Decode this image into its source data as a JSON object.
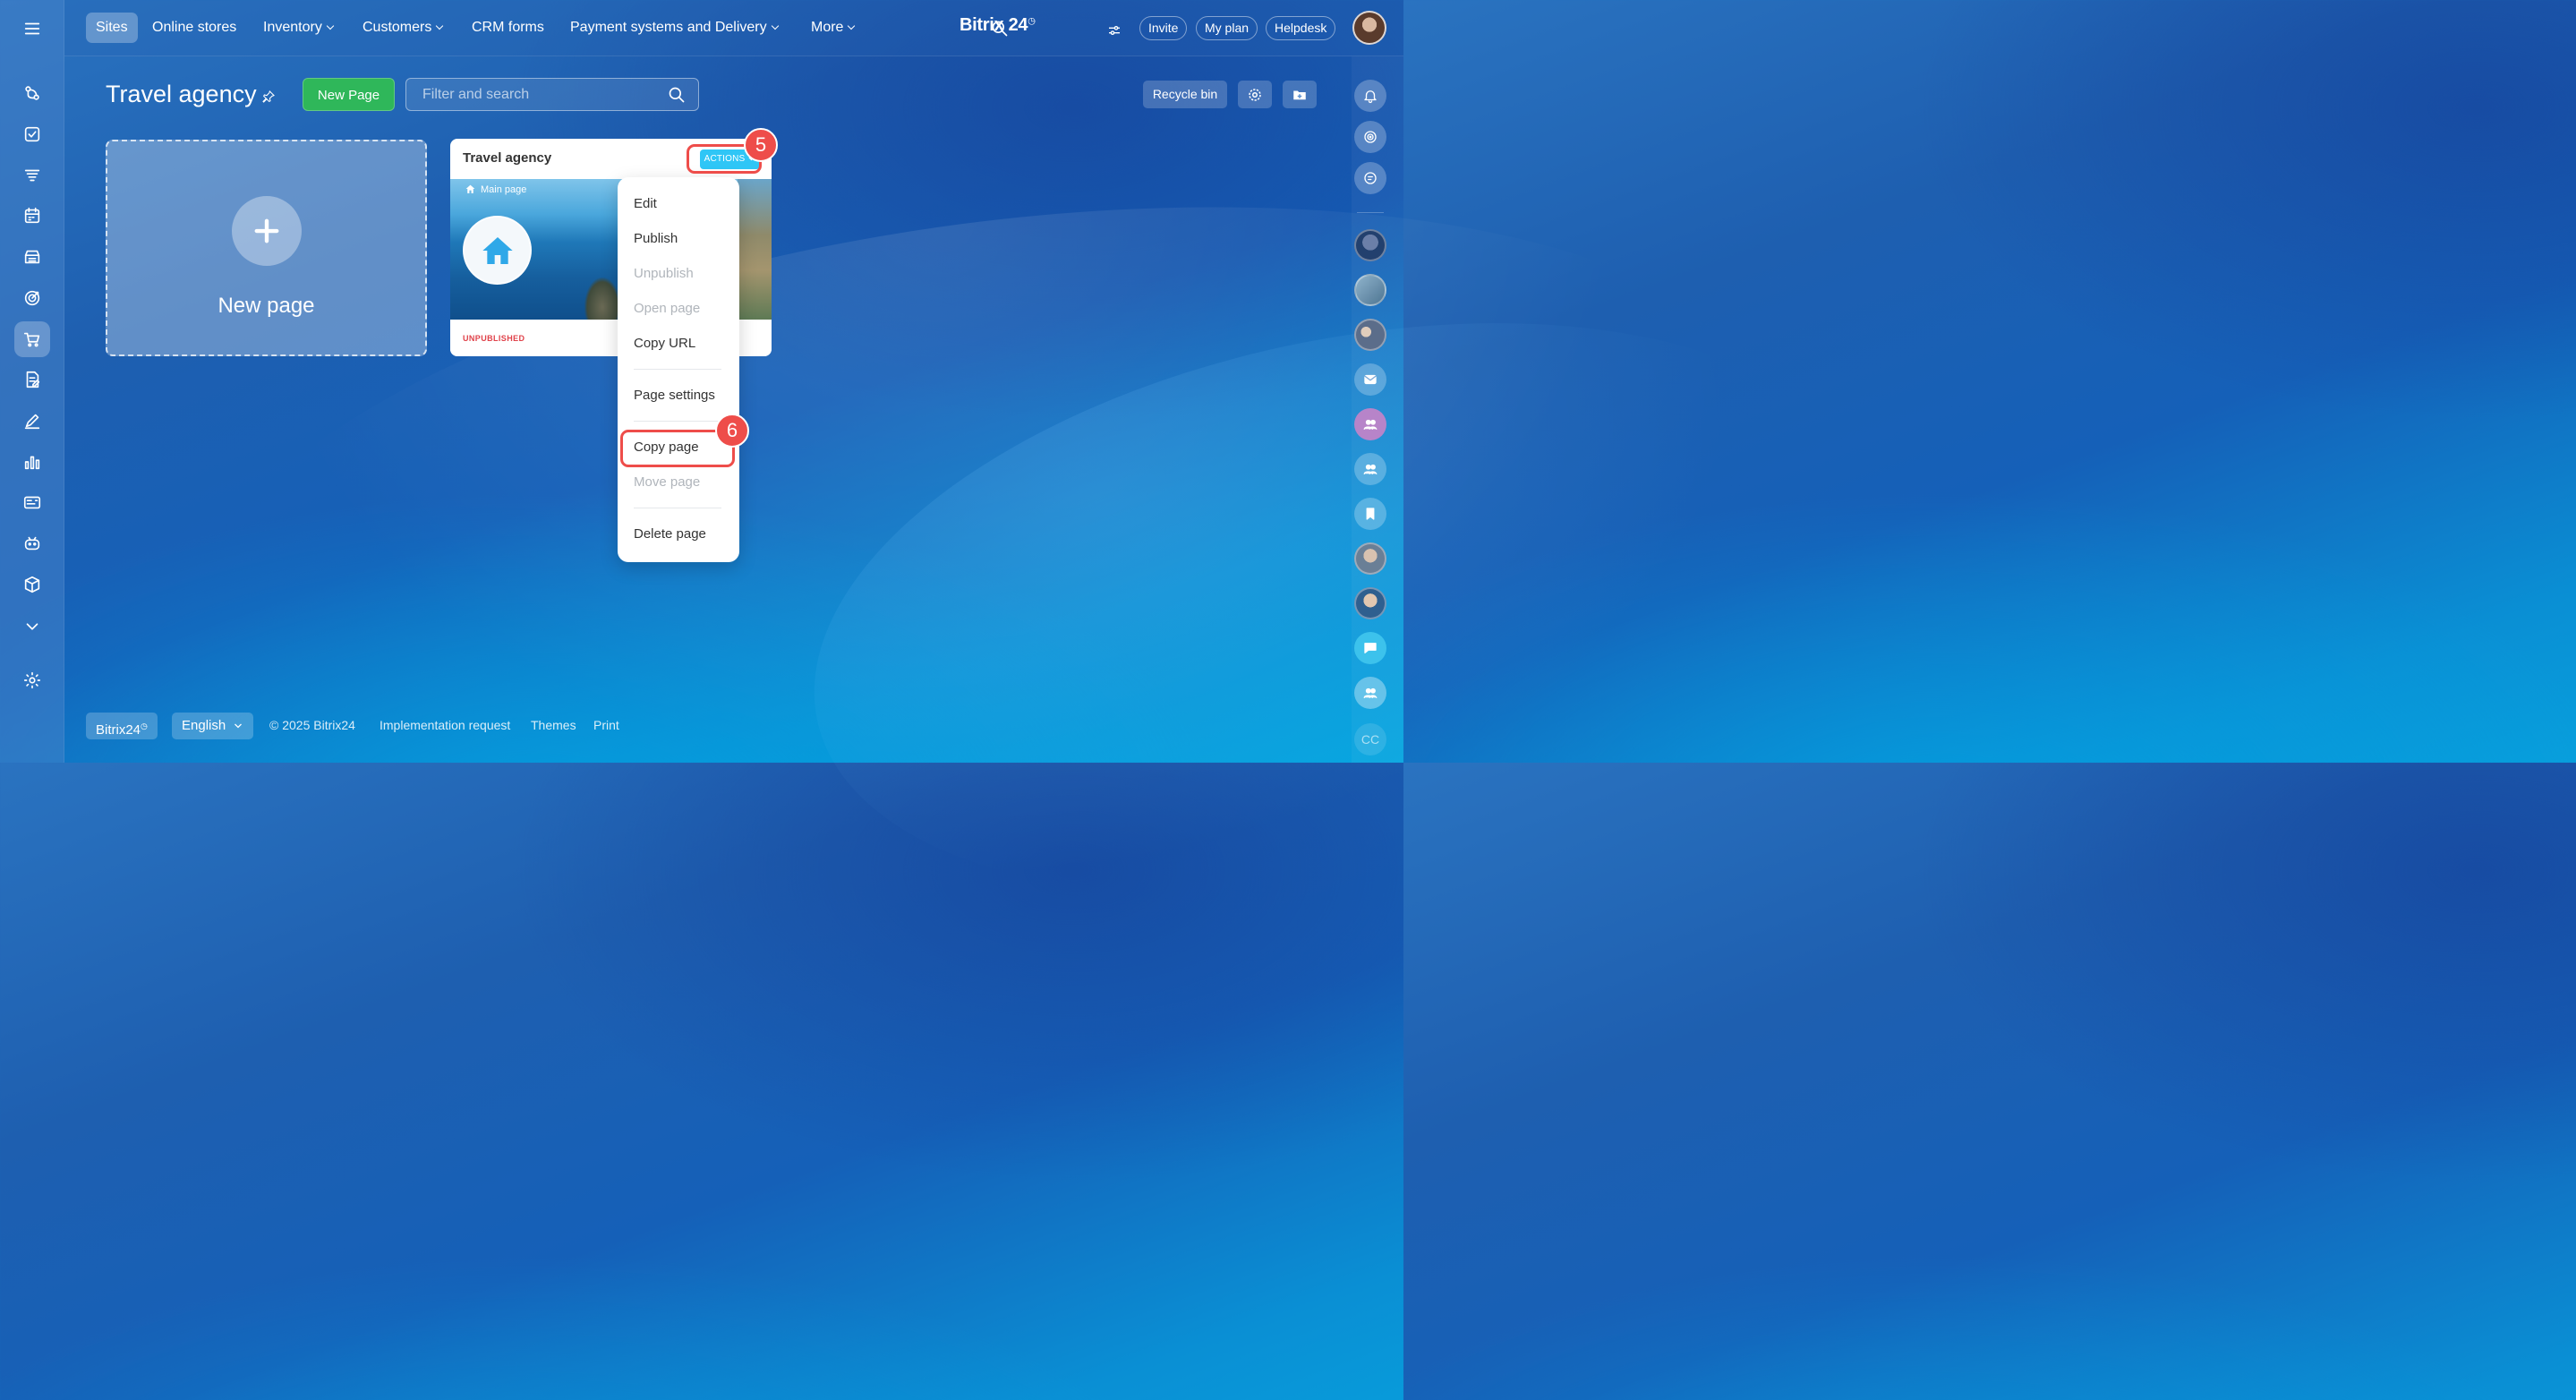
{
  "topnav": {
    "items": [
      {
        "label": "Sites",
        "has_dropdown": false,
        "active": true
      },
      {
        "label": "Online stores",
        "has_dropdown": false
      },
      {
        "label": "Inventory",
        "has_dropdown": true
      },
      {
        "label": "Customers",
        "has_dropdown": true
      },
      {
        "label": "CRM forms",
        "has_dropdown": false
      },
      {
        "label": "Payment systems and Delivery",
        "has_dropdown": true
      },
      {
        "label": "More",
        "has_dropdown": true
      }
    ],
    "brand": "Bitrix 24",
    "invite": "Invite",
    "my_plan": "My plan",
    "helpdesk": "Helpdesk"
  },
  "page": {
    "title": "Travel agency",
    "new_page_button": "New Page",
    "search_placeholder": "Filter and search",
    "recycle_bin": "Recycle bin"
  },
  "new_card": {
    "label": "New page"
  },
  "site_card": {
    "title": "Travel agency",
    "actions_label": "ACTIONS",
    "main_page_label": "Main page",
    "status": "UNPUBLISHED"
  },
  "menu": {
    "items": [
      {
        "label": "Edit",
        "disabled": false
      },
      {
        "label": "Publish",
        "disabled": false
      },
      {
        "label": "Unpublish",
        "disabled": true
      },
      {
        "label": "Open page",
        "disabled": true
      },
      {
        "label": "Copy URL",
        "disabled": false
      },
      {
        "label": "Page settings",
        "disabled": false
      },
      {
        "label": "Copy page",
        "disabled": false
      },
      {
        "label": "Move page",
        "disabled": true
      },
      {
        "label": "Delete page",
        "disabled": false
      }
    ]
  },
  "annotations": {
    "step5": "5",
    "step6": "6"
  },
  "footer": {
    "brand": "Bitrix24",
    "language": "English",
    "copyright": "© 2025 Bitrix24",
    "implementation": "Implementation request",
    "themes": "Themes",
    "print": "Print"
  },
  "right_bar": {
    "cc_label": "CC"
  },
  "colors": {
    "accent_green": "#2fb75a",
    "actions_blue": "#2fc6f6",
    "annotation_red": "#ee4d4a",
    "status_red": "#e0424a"
  },
  "icons": {
    "left_sidebar": [
      "menu-icon",
      "crm-icon",
      "tasks-icon",
      "filter-icon",
      "calendar-icon",
      "store-icon",
      "target-icon",
      "cart-icon",
      "document-icon",
      "signature-icon",
      "analytics-icon",
      "cards-icon",
      "robot-icon",
      "box-icon",
      "chevron-down-icon",
      "settings-icon"
    ]
  }
}
